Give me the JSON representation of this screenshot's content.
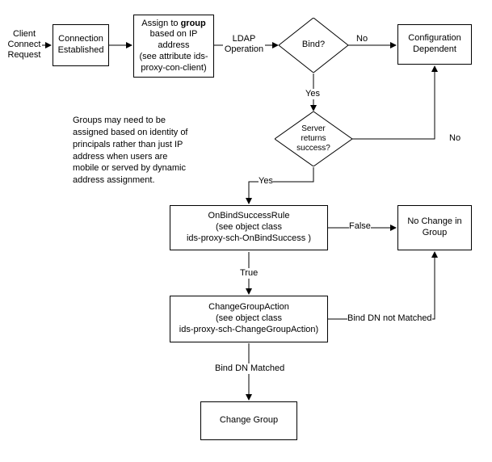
{
  "chart_data": {
    "type": "flowchart",
    "nodes": [
      {
        "id": "start",
        "kind": "label",
        "text": "Client Connect Request"
      },
      {
        "id": "conn",
        "kind": "process",
        "text": "Connection Established"
      },
      {
        "id": "assign",
        "kind": "process",
        "text_html": "Assign to <b>group</b> based on IP address<br>(see attribute ids-proxy-con-client)"
      },
      {
        "id": "bind",
        "kind": "decision",
        "text": "Bind?"
      },
      {
        "id": "config",
        "kind": "process",
        "text": "Configuration Dependent"
      },
      {
        "id": "srv",
        "kind": "decision",
        "text": "Server returns success?"
      },
      {
        "id": "obsr",
        "kind": "process",
        "text_html": "OnBindSuccessRule<br>(see object class<br>ids-proxy-sch-OnBindSuccess )"
      },
      {
        "id": "nochg",
        "kind": "process",
        "text": "No Change in Group"
      },
      {
        "id": "cga",
        "kind": "process",
        "text_html": "ChangeGroupAction<br>(see object class<br>ids-proxy-sch-ChangeGroupAction)"
      },
      {
        "id": "chgrp",
        "kind": "process",
        "text": "Change Group"
      }
    ],
    "edges": [
      {
        "from": "start",
        "to": "conn",
        "label": ""
      },
      {
        "from": "conn",
        "to": "assign",
        "label": ""
      },
      {
        "from": "assign",
        "to": "bind",
        "label": "LDAP Operation"
      },
      {
        "from": "bind",
        "to": "config",
        "label": "No"
      },
      {
        "from": "bind",
        "to": "srv",
        "label": "Yes"
      },
      {
        "from": "srv",
        "to": "config",
        "label": "No"
      },
      {
        "from": "srv",
        "to": "obsr",
        "label": "Yes"
      },
      {
        "from": "obsr",
        "to": "nochg",
        "label": "False"
      },
      {
        "from": "obsr",
        "to": "cga",
        "label": "True"
      },
      {
        "from": "cga",
        "to": "nochg",
        "label": "Bind DN not Matched"
      },
      {
        "from": "cga",
        "to": "chgrp",
        "label": "Bind DN Matched"
      }
    ],
    "annotation": "Groups may need to be assigned based on identity of principals rather than just IP address when users are mobile or served by dynamic address assignment."
  },
  "labels": {
    "start": "Client\nConnect\nRequest",
    "conn": "Connection\nEstablished",
    "bind": "Bind?",
    "config": "Configuration\nDependent",
    "srv": "Server\nreturns\nsuccess?",
    "nochg": "No Change in\nGroup",
    "chgrp": "Change Group",
    "ldap": "LDAP\nOperation",
    "no1": "No",
    "yes1": "Yes",
    "no2": "No",
    "yes2": "Yes",
    "false": "False",
    "true": "True",
    "bdnm": "Bind DN Matched",
    "bdnnm": "Bind DN not Matched"
  },
  "html_labels": {
    "assign": "Assign to <b>group</b><br>based on IP<br>address<br>(see attribute ids-<br>proxy-con-client)",
    "obsr": "OnBindSuccessRule<br>(see object class<br>ids-proxy-sch-OnBindSuccess )",
    "cga": "ChangeGroupAction<br>(see object class<br>ids-proxy-sch-ChangeGroupAction)"
  },
  "annotation": "Groups may need to be\nassigned based on identity of\nprincipals rather than just IP\naddress when users are\nmobile or served by dynamic\naddress assignment."
}
